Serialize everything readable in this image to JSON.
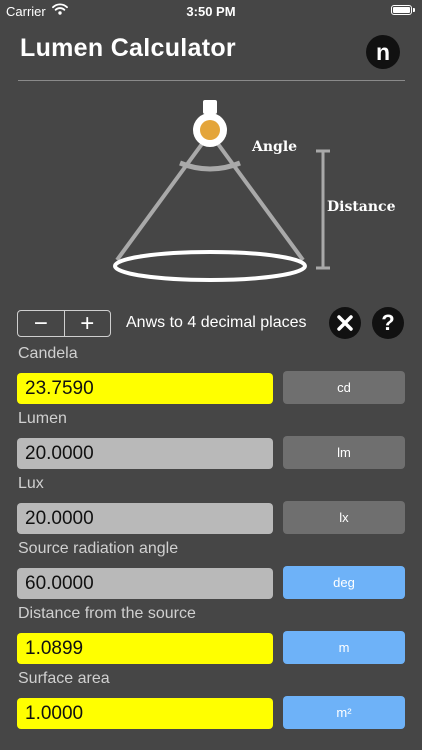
{
  "status": {
    "carrier": "Carrier",
    "time": "3:50 PM"
  },
  "header": {
    "title": "Lumen Calculator",
    "logo_letter": "n"
  },
  "diagram": {
    "angle_label": "Angle",
    "distance_label": "Distance",
    "colors": {
      "lines": "#a9a9a9",
      "lamp": "#e4a53a",
      "ellipse": "#ffffff"
    }
  },
  "controls": {
    "minus_label": "−",
    "plus_label": "+",
    "decimal_text": "Anws to 4 decimal places",
    "help_label": "?"
  },
  "fields": [
    {
      "label": "Candela",
      "value": "23.7590",
      "unit": "cd",
      "input_style": "yellow",
      "unit_style": "gray"
    },
    {
      "label": "Lumen",
      "value": "20.0000",
      "unit": "lm",
      "input_style": "gray",
      "unit_style": "gray"
    },
    {
      "label": "Lux",
      "value": "20.0000",
      "unit": "lx",
      "input_style": "gray",
      "unit_style": "gray"
    },
    {
      "label": "Source radiation angle",
      "value": "60.0000",
      "unit": "deg",
      "input_style": "gray",
      "unit_style": "blue"
    },
    {
      "label": "Distance from the source",
      "value": "1.0899",
      "unit": "m",
      "input_style": "yellow",
      "unit_style": "blue"
    },
    {
      "label": "Surface area",
      "value": "1.0000",
      "unit": "m²",
      "input_style": "yellow",
      "unit_style": "blue"
    }
  ],
  "colors": {
    "background": "#464646",
    "yellow_input": "#ffff00",
    "gray_input": "#b9b9b9",
    "unit_gray": "#6f6f6f",
    "unit_blue": "#6eb2f8"
  }
}
